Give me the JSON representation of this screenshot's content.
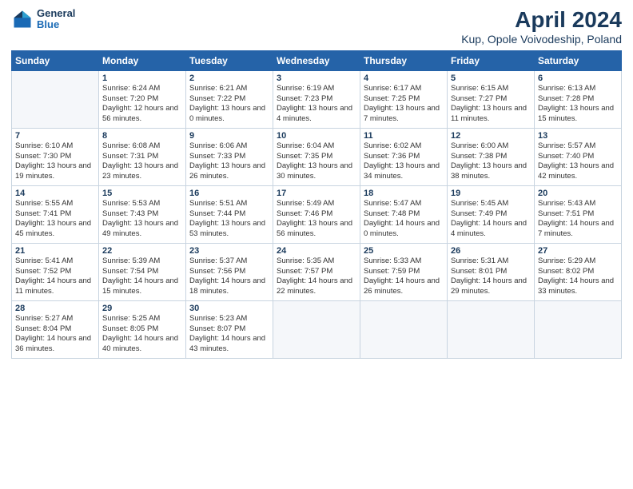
{
  "header": {
    "logo_line1": "General",
    "logo_line2": "Blue",
    "main_title": "April 2024",
    "sub_title": "Kup, Opole Voivodeship, Poland"
  },
  "weekdays": [
    "Sunday",
    "Monday",
    "Tuesday",
    "Wednesday",
    "Thursday",
    "Friday",
    "Saturday"
  ],
  "weeks": [
    [
      {
        "day": "",
        "empty": true
      },
      {
        "day": "1",
        "sunrise": "Sunrise: 6:24 AM",
        "sunset": "Sunset: 7:20 PM",
        "daylight": "Daylight: 12 hours and 56 minutes."
      },
      {
        "day": "2",
        "sunrise": "Sunrise: 6:21 AM",
        "sunset": "Sunset: 7:22 PM",
        "daylight": "Daylight: 13 hours and 0 minutes."
      },
      {
        "day": "3",
        "sunrise": "Sunrise: 6:19 AM",
        "sunset": "Sunset: 7:23 PM",
        "daylight": "Daylight: 13 hours and 4 minutes."
      },
      {
        "day": "4",
        "sunrise": "Sunrise: 6:17 AM",
        "sunset": "Sunset: 7:25 PM",
        "daylight": "Daylight: 13 hours and 7 minutes."
      },
      {
        "day": "5",
        "sunrise": "Sunrise: 6:15 AM",
        "sunset": "Sunset: 7:27 PM",
        "daylight": "Daylight: 13 hours and 11 minutes."
      },
      {
        "day": "6",
        "sunrise": "Sunrise: 6:13 AM",
        "sunset": "Sunset: 7:28 PM",
        "daylight": "Daylight: 13 hours and 15 minutes."
      }
    ],
    [
      {
        "day": "7",
        "sunrise": "Sunrise: 6:10 AM",
        "sunset": "Sunset: 7:30 PM",
        "daylight": "Daylight: 13 hours and 19 minutes."
      },
      {
        "day": "8",
        "sunrise": "Sunrise: 6:08 AM",
        "sunset": "Sunset: 7:31 PM",
        "daylight": "Daylight: 13 hours and 23 minutes."
      },
      {
        "day": "9",
        "sunrise": "Sunrise: 6:06 AM",
        "sunset": "Sunset: 7:33 PM",
        "daylight": "Daylight: 13 hours and 26 minutes."
      },
      {
        "day": "10",
        "sunrise": "Sunrise: 6:04 AM",
        "sunset": "Sunset: 7:35 PM",
        "daylight": "Daylight: 13 hours and 30 minutes."
      },
      {
        "day": "11",
        "sunrise": "Sunrise: 6:02 AM",
        "sunset": "Sunset: 7:36 PM",
        "daylight": "Daylight: 13 hours and 34 minutes."
      },
      {
        "day": "12",
        "sunrise": "Sunrise: 6:00 AM",
        "sunset": "Sunset: 7:38 PM",
        "daylight": "Daylight: 13 hours and 38 minutes."
      },
      {
        "day": "13",
        "sunrise": "Sunrise: 5:57 AM",
        "sunset": "Sunset: 7:40 PM",
        "daylight": "Daylight: 13 hours and 42 minutes."
      }
    ],
    [
      {
        "day": "14",
        "sunrise": "Sunrise: 5:55 AM",
        "sunset": "Sunset: 7:41 PM",
        "daylight": "Daylight: 13 hours and 45 minutes."
      },
      {
        "day": "15",
        "sunrise": "Sunrise: 5:53 AM",
        "sunset": "Sunset: 7:43 PM",
        "daylight": "Daylight: 13 hours and 49 minutes."
      },
      {
        "day": "16",
        "sunrise": "Sunrise: 5:51 AM",
        "sunset": "Sunset: 7:44 PM",
        "daylight": "Daylight: 13 hours and 53 minutes."
      },
      {
        "day": "17",
        "sunrise": "Sunrise: 5:49 AM",
        "sunset": "Sunset: 7:46 PM",
        "daylight": "Daylight: 13 hours and 56 minutes."
      },
      {
        "day": "18",
        "sunrise": "Sunrise: 5:47 AM",
        "sunset": "Sunset: 7:48 PM",
        "daylight": "Daylight: 14 hours and 0 minutes."
      },
      {
        "day": "19",
        "sunrise": "Sunrise: 5:45 AM",
        "sunset": "Sunset: 7:49 PM",
        "daylight": "Daylight: 14 hours and 4 minutes."
      },
      {
        "day": "20",
        "sunrise": "Sunrise: 5:43 AM",
        "sunset": "Sunset: 7:51 PM",
        "daylight": "Daylight: 14 hours and 7 minutes."
      }
    ],
    [
      {
        "day": "21",
        "sunrise": "Sunrise: 5:41 AM",
        "sunset": "Sunset: 7:52 PM",
        "daylight": "Daylight: 14 hours and 11 minutes."
      },
      {
        "day": "22",
        "sunrise": "Sunrise: 5:39 AM",
        "sunset": "Sunset: 7:54 PM",
        "daylight": "Daylight: 14 hours and 15 minutes."
      },
      {
        "day": "23",
        "sunrise": "Sunrise: 5:37 AM",
        "sunset": "Sunset: 7:56 PM",
        "daylight": "Daylight: 14 hours and 18 minutes."
      },
      {
        "day": "24",
        "sunrise": "Sunrise: 5:35 AM",
        "sunset": "Sunset: 7:57 PM",
        "daylight": "Daylight: 14 hours and 22 minutes."
      },
      {
        "day": "25",
        "sunrise": "Sunrise: 5:33 AM",
        "sunset": "Sunset: 7:59 PM",
        "daylight": "Daylight: 14 hours and 26 minutes."
      },
      {
        "day": "26",
        "sunrise": "Sunrise: 5:31 AM",
        "sunset": "Sunset: 8:01 PM",
        "daylight": "Daylight: 14 hours and 29 minutes."
      },
      {
        "day": "27",
        "sunrise": "Sunrise: 5:29 AM",
        "sunset": "Sunset: 8:02 PM",
        "daylight": "Daylight: 14 hours and 33 minutes."
      }
    ],
    [
      {
        "day": "28",
        "sunrise": "Sunrise: 5:27 AM",
        "sunset": "Sunset: 8:04 PM",
        "daylight": "Daylight: 14 hours and 36 minutes."
      },
      {
        "day": "29",
        "sunrise": "Sunrise: 5:25 AM",
        "sunset": "Sunset: 8:05 PM",
        "daylight": "Daylight: 14 hours and 40 minutes."
      },
      {
        "day": "30",
        "sunrise": "Sunrise: 5:23 AM",
        "sunset": "Sunset: 8:07 PM",
        "daylight": "Daylight: 14 hours and 43 minutes."
      },
      {
        "day": "",
        "empty": true
      },
      {
        "day": "",
        "empty": true
      },
      {
        "day": "",
        "empty": true
      },
      {
        "day": "",
        "empty": true
      }
    ]
  ]
}
